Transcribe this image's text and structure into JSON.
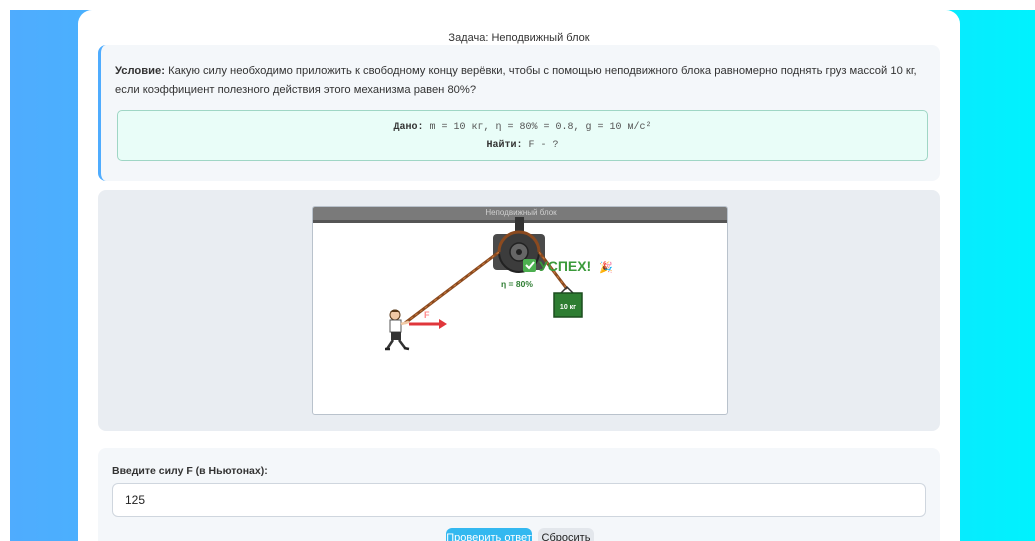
{
  "page": {
    "task_title": "Задача: Неподвижный блок"
  },
  "condition": {
    "label": "Условие:",
    "text": " Какую силу необходимо приложить к свободному концу верёвки, чтобы с помощью неподвижного блока равномерно поднять груз массой 10 кг, если коэффициент полезного действия этого механизма равен 80%?"
  },
  "given": {
    "label": "Дано:",
    "text": " m = 10 кг, η = 80% = 0.8, g = 10 м/с²",
    "find_label": "Найти:",
    "find_text": " F - ?"
  },
  "simulation": {
    "header": "Неподвижный блок",
    "success_text": "УСПЕХ!",
    "success_emoji": "🎉",
    "efficiency": "η = 80%",
    "load_label": "10 кг",
    "force_label": "F",
    "check_icon": "check-mark-icon"
  },
  "form": {
    "label": "Введите силу F (в Ньютонах):",
    "value": "125",
    "check_button": "Проверить ответ",
    "reset_button": "Сбросить"
  },
  "colors": {
    "gradient_start": "#4facfe",
    "gradient_end": "#00f2fe",
    "accent": "#33b8f0",
    "success": "#3a9a3a",
    "rope": "#8b4a1f",
    "force_arrow": "#e0363b"
  }
}
